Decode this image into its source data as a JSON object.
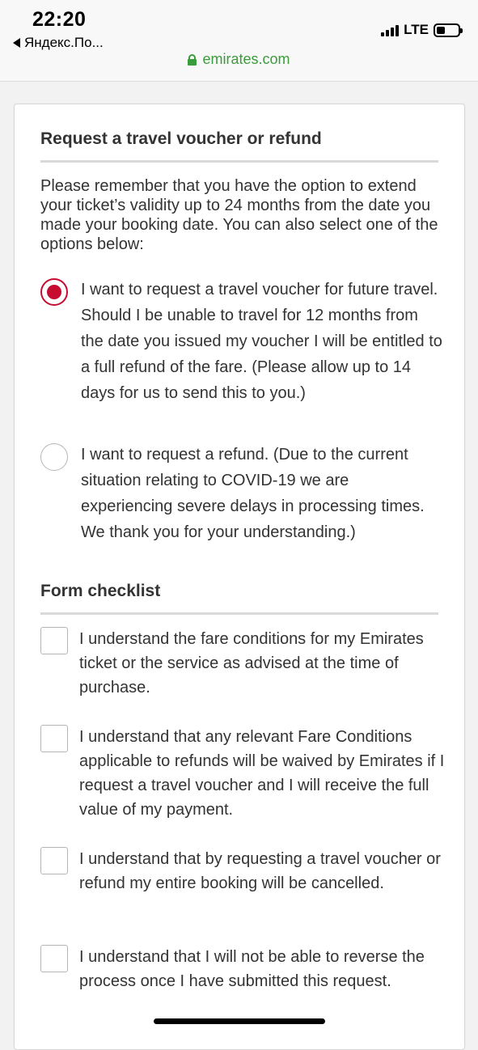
{
  "status_bar": {
    "time": "22:20",
    "back_app": "Яндекс.По...",
    "network": "LTE",
    "battery_level": 0.4
  },
  "browser": {
    "url": "emirates.com",
    "lock_icon": "lock-icon",
    "url_color": "#3b9c3b"
  },
  "form": {
    "section_title": "Request a travel voucher or refund",
    "intro": "Please remember that you have the option to extend your ticket’s validity up to 24 months from the date you made your booking date. You can also select one of the options below:",
    "options": [
      {
        "label": "I want to request a travel voucher for future travel. Should I be unable to travel for 12 months from the date you issued my voucher I will be entitled to a full refund of the fare. (Please allow up to 14 days for us to send this to you.)",
        "selected": true
      },
      {
        "label": "I want to request a refund. (Due to the current situation relating to COVID-19 we are experiencing severe delays in processing times. We thank you for your understanding.)",
        "selected": false
      }
    ],
    "checklist_title": "Form checklist",
    "checklist": [
      {
        "label": "I understand the fare conditions for my Emirates ticket or the service as advised at the time of purchase.",
        "checked": false
      },
      {
        "label": "I understand that any relevant Fare Conditions applicable to refunds will be waived by Emirates if I request a travel voucher and I will receive the full value of my payment.",
        "checked": false
      },
      {
        "label": "I understand that by requesting a travel voucher or refund my entire booking will be cancelled.",
        "checked": false
      },
      {
        "label": "I understand that I will not be able to reverse the process once I have submitted this request.",
        "checked": false
      }
    ]
  },
  "colors": {
    "accent": "#c60c30",
    "text": "#333333",
    "border": "#b5b5b5"
  }
}
